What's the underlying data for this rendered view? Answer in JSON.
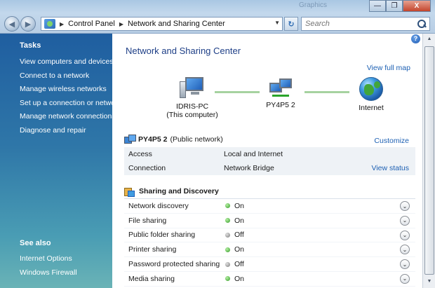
{
  "window": {
    "ghost_title": "Graphics",
    "minimize_label": "—",
    "maximize_label": "❐",
    "close_label": "X"
  },
  "toolbar": {
    "back_glyph": "◀",
    "forward_glyph": "▶",
    "breadcrumbs": [
      "Control Panel",
      "Network and Sharing Center"
    ],
    "separator": "▶",
    "refresh_glyph": "↻",
    "search_placeholder": "Search"
  },
  "sidebar": {
    "heading": "Tasks",
    "items": [
      {
        "label": "View computers and devices"
      },
      {
        "label": "Connect to a network"
      },
      {
        "label": "Manage wireless networks"
      },
      {
        "label": "Set up a connection or network"
      },
      {
        "label": "Manage network connections"
      },
      {
        "label": "Diagnose and repair"
      }
    ],
    "see_also_heading": "See also",
    "see_also": [
      {
        "label": "Internet Options"
      },
      {
        "label": "Windows Firewall"
      }
    ]
  },
  "main": {
    "title": "Network and Sharing Center",
    "view_full_map": "View full map",
    "help_glyph": "?",
    "map": {
      "computer_name": "IDRIS-PC",
      "computer_sub": "(This computer)",
      "network_name": "PY4P5  2",
      "internet_label": "Internet"
    },
    "network": {
      "name": "PY4P5  2",
      "type": "(Public network)",
      "customize": "Customize",
      "rows": [
        {
          "label": "Access",
          "value": "Local and Internet"
        },
        {
          "label": "Connection",
          "value": "Network Bridge",
          "action": "View status"
        }
      ]
    },
    "sharing": {
      "heading": "Sharing and Discovery",
      "rows": [
        {
          "label": "Network discovery",
          "state": "On"
        },
        {
          "label": "File sharing",
          "state": "On"
        },
        {
          "label": "Public folder sharing",
          "state": "Off"
        },
        {
          "label": "Printer sharing",
          "state": "On"
        },
        {
          "label": "Password protected sharing",
          "state": "Off"
        },
        {
          "label": "Media sharing",
          "state": "On"
        }
      ]
    }
  },
  "scrollbar": {
    "up_glyph": "▲",
    "down_glyph": "▼"
  },
  "colors": {
    "link": "#1d60b3",
    "title": "#1e3f87",
    "on": "#2f9a24",
    "off": "#7a7a7a",
    "sidebar_top": "#1f5ea0"
  },
  "icons": [
    "back-arrow-icon",
    "forward-arrow-icon",
    "control-panel-icon",
    "refresh-icon",
    "search-icon",
    "computer-icon",
    "network-icon",
    "globe-icon",
    "help-icon",
    "sharing-icon",
    "expand-chevron-icon"
  ]
}
